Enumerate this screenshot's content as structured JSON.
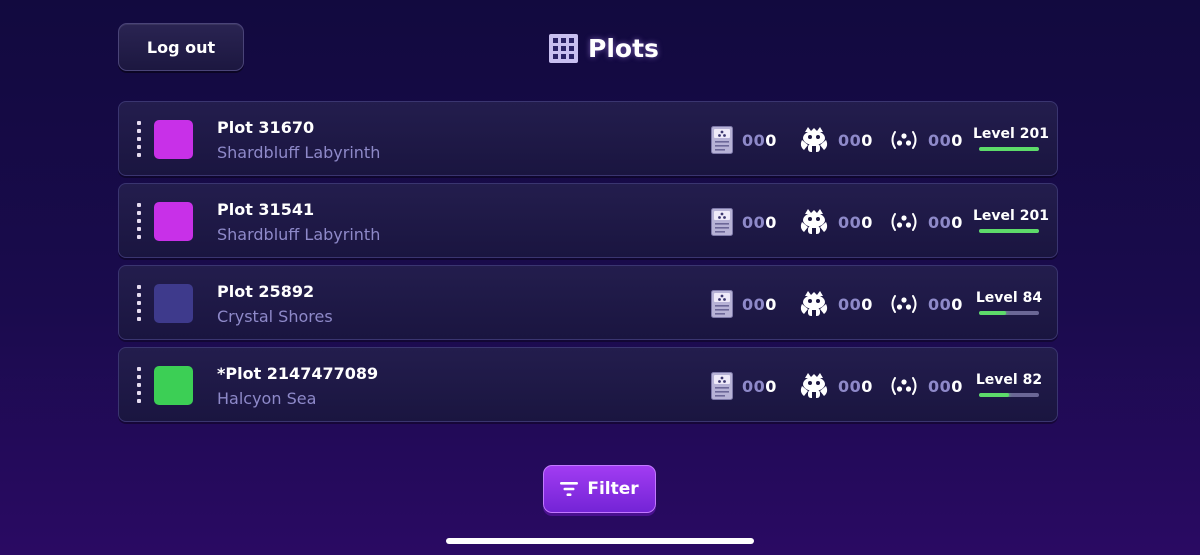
{
  "header": {
    "logout_label": "Log out",
    "title": "Plots",
    "title_icon": "grid-icon"
  },
  "plots": [
    {
      "name": "Plot 31670",
      "location": "Shardbluff Labyrinth",
      "color": "#c830e8",
      "stats": [
        {
          "icon": "card-icon",
          "dim": "00",
          "lit": "0"
        },
        {
          "icon": "creature-icon",
          "dim": "00",
          "lit": "0"
        },
        {
          "icon": "cluster-icon",
          "dim": "00",
          "lit": "0"
        }
      ],
      "level_label": "Level 201",
      "level_progress": 1.0
    },
    {
      "name": "Plot 31541",
      "location": "Shardbluff Labyrinth",
      "color": "#c830e8",
      "stats": [
        {
          "icon": "card-icon",
          "dim": "00",
          "lit": "0"
        },
        {
          "icon": "creature-icon",
          "dim": "00",
          "lit": "0"
        },
        {
          "icon": "cluster-icon",
          "dim": "00",
          "lit": "0"
        }
      ],
      "level_label": "Level 201",
      "level_progress": 1.0
    },
    {
      "name": "Plot 25892",
      "location": "Crystal Shores",
      "color": "#3e3a8c",
      "stats": [
        {
          "icon": "card-icon",
          "dim": "00",
          "lit": "0"
        },
        {
          "icon": "creature-icon",
          "dim": "00",
          "lit": "0"
        },
        {
          "icon": "cluster-icon",
          "dim": "00",
          "lit": "0"
        }
      ],
      "level_label": "Level 84",
      "level_progress": 0.45
    },
    {
      "name": "*Plot 2147477089",
      "location": "Halcyon Sea",
      "color": "#3ccf55",
      "stats": [
        {
          "icon": "card-icon",
          "dim": "00",
          "lit": "0"
        },
        {
          "icon": "creature-icon",
          "dim": "00",
          "lit": "0"
        },
        {
          "icon": "cluster-icon",
          "dim": "00",
          "lit": "0"
        }
      ],
      "level_label": "Level 82",
      "level_progress": 0.5
    }
  ],
  "footer": {
    "filter_label": "Filter",
    "filter_icon": "filter-icon"
  },
  "colors": {
    "accent": "#8a30e6",
    "level_bar": "#5ddb6a",
    "muted_text": "#8e89c9"
  }
}
